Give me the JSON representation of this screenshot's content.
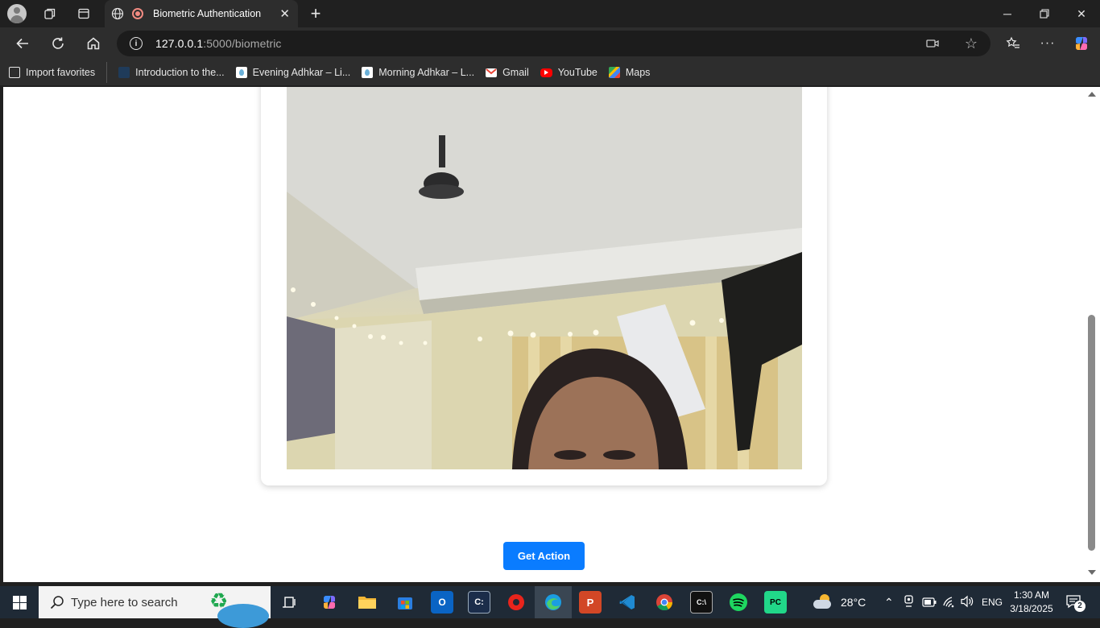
{
  "browser": {
    "tab_title": "Biometric Authentication",
    "url_host": "127.0.0.1",
    "url_path": ":5000/biometric",
    "bookmarks": [
      {
        "label": "Import favorites",
        "icon": "import-icon",
        "color": "#e6e6e6"
      },
      {
        "label": "Introduction to the...",
        "icon": "page-icon",
        "color": "#1f3b5a"
      },
      {
        "label": "Evening Adhkar – Li...",
        "icon": "drop-icon",
        "color": "#ffffff"
      },
      {
        "label": "Morning Adhkar – L...",
        "icon": "drop-icon",
        "color": "#ffffff"
      },
      {
        "label": "Gmail",
        "icon": "gmail-icon",
        "color": "#ea4335"
      },
      {
        "label": "YouTube",
        "icon": "youtube-icon",
        "color": "#ff0000"
      },
      {
        "label": "Maps",
        "icon": "maps-icon",
        "color": "#34a853"
      }
    ]
  },
  "page": {
    "action_button": "Get Action"
  },
  "taskbar": {
    "search_placeholder": "Type here to search",
    "weather": "28°C",
    "language": "ENG",
    "time": "1:30 AM",
    "date": "3/18/2025",
    "notification_count": "2"
  },
  "colors": {
    "accent": "#0a7cff",
    "browser_bg": "#202020",
    "taskbar_bg": "#1f2a36"
  }
}
